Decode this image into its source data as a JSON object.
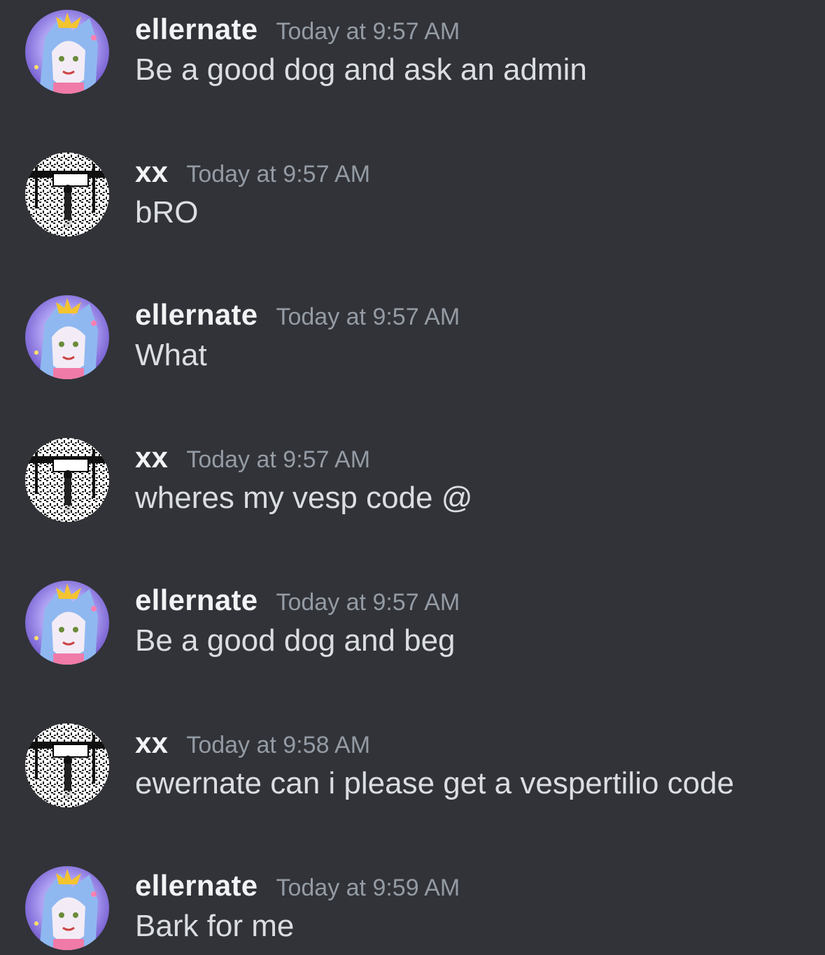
{
  "messages": [
    {
      "author": "ellernate",
      "avatar": "ellernate-avatar",
      "time": "Today at 9:57 AM",
      "text": "Be a good dog and ask an admin"
    },
    {
      "author": "xx",
      "avatar": "xx-avatar",
      "time": "Today at 9:57 AM",
      "text": "bRO"
    },
    {
      "author": "ellernate",
      "avatar": "ellernate-avatar",
      "time": "Today at 9:57 AM",
      "text": "What"
    },
    {
      "author": "xx",
      "avatar": "xx-avatar",
      "time": "Today at 9:57 AM",
      "text": "wheres my vesp code @"
    },
    {
      "author": "ellernate",
      "avatar": "ellernate-avatar",
      "time": "Today at 9:57 AM",
      "text": "Be a good dog and beg"
    },
    {
      "author": "xx",
      "avatar": "xx-avatar",
      "time": "Today at 9:58 AM",
      "text": "ewernate can i please get a vespertilio code"
    },
    {
      "author": "ellernate",
      "avatar": "ellernate-avatar",
      "time": "Today at 9:59 AM",
      "text": "Bark for me"
    }
  ],
  "colors": {
    "background": "#313338",
    "username": "#f2f3f5",
    "timestamp": "#949ba4",
    "message_text": "#dbdee1"
  }
}
